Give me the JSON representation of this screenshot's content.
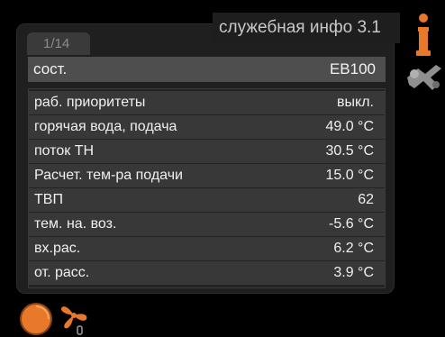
{
  "header": {
    "title": "служебная инфо  3.1",
    "page_indicator": "1/14"
  },
  "status_row": {
    "label": "сост.",
    "value": "EB100"
  },
  "rows": [
    {
      "label": "раб. приоритеты",
      "value": "выкл."
    },
    {
      "label": "горячая вода, подача",
      "value": "49.0  °C"
    },
    {
      "label": "поток ТН",
      "value": "30.5  °C"
    },
    {
      "label": "Расчет. тем-ра подачи",
      "value": "15.0  °C"
    },
    {
      "label": "ТВП",
      "value": "62"
    },
    {
      "label": "тем. на. воз.",
      "value": "-5.6  °C"
    },
    {
      "label": "вх.рас.",
      "value": "6.2  °C"
    },
    {
      "label": "от. расс.",
      "value": "3.9  °C"
    }
  ],
  "icons": {
    "info": "info-icon",
    "tools": "tools-icon",
    "dial": "dial-icon",
    "fan": "fan-icon"
  },
  "colors": {
    "accent_orange": "#e8782a",
    "background": "#000000",
    "panel": "#1f1f1f",
    "header_row": "#4e4e4e",
    "row": "#383838",
    "text": "#f0f0f0"
  }
}
